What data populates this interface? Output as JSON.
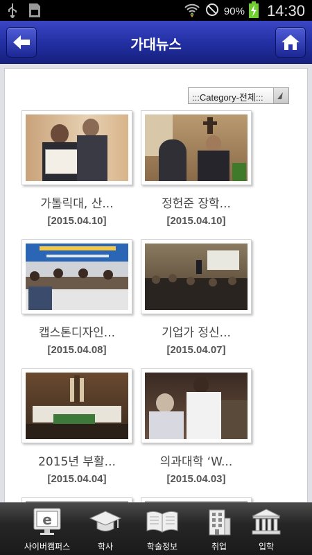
{
  "status_bar": {
    "battery": "90%",
    "time": "14:30"
  },
  "header": {
    "title": "가대뉴스"
  },
  "filter": {
    "category": ":::Category-전체:::"
  },
  "news": [
    {
      "title": "가톨릭대, 산...",
      "date": "[2015.04.10]"
    },
    {
      "title": "정헌준 장학...",
      "date": "[2015.04.10]"
    },
    {
      "title": "캡스톤디자인...",
      "date": "[2015.04.08]"
    },
    {
      "title": "기업가 정신...",
      "date": "[2015.04.07]"
    },
    {
      "title": "2015년 부활...",
      "date": "[2015.04.04]"
    },
    {
      "title": "의과대학 ‘W...",
      "date": "[2015.04.03]"
    }
  ],
  "bottom_nav": [
    {
      "label": "사이버캠퍼스",
      "icon": "e-monitor-icon"
    },
    {
      "label": "학사",
      "icon": "graduation-cap-icon"
    },
    {
      "label": "학술정보",
      "icon": "open-book-icon"
    },
    {
      "label": "취업",
      "icon": "building-icon"
    },
    {
      "label": "입학",
      "icon": "institution-icon"
    }
  ]
}
